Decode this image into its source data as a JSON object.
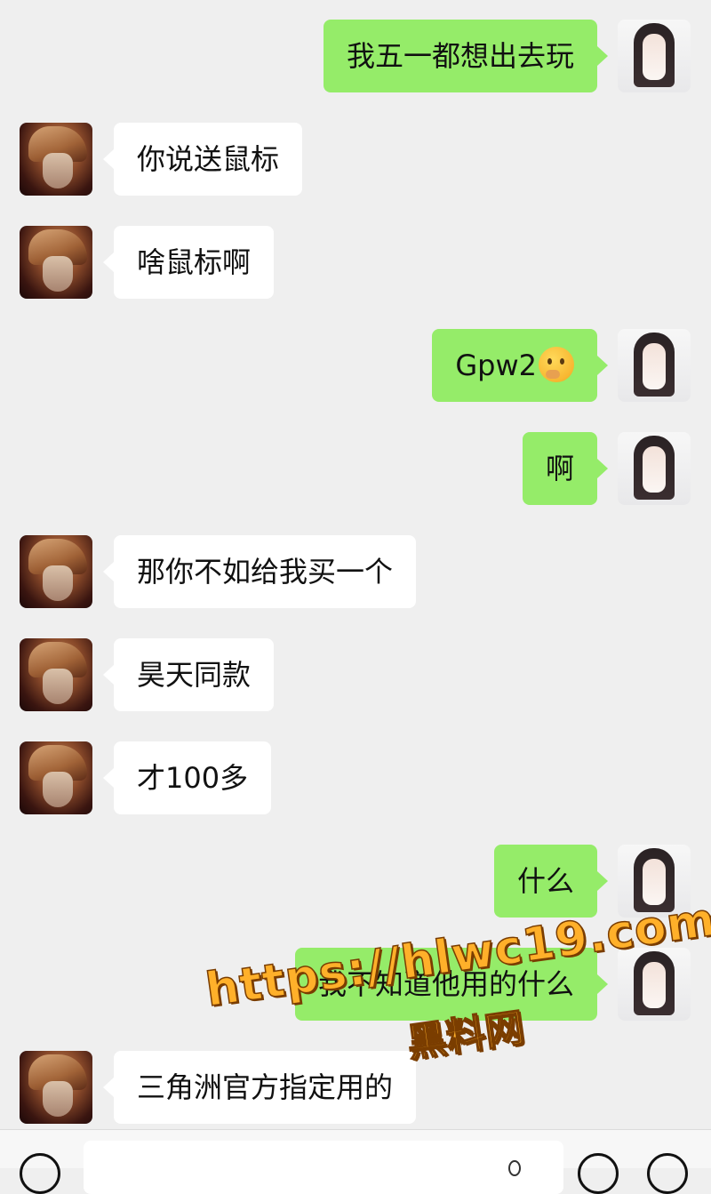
{
  "messages": [
    {
      "side": "right",
      "text": "我五一都想出去玩"
    },
    {
      "side": "left",
      "text": "你说送鼠标"
    },
    {
      "side": "left",
      "text": "啥鼠标啊"
    },
    {
      "side": "right",
      "text": "Gpw2",
      "emoji": "thinking-face-emoji"
    },
    {
      "side": "right",
      "text": "啊"
    },
    {
      "side": "left",
      "text": "那你不如给我买一个"
    },
    {
      "side": "left",
      "text": "昊天同款"
    },
    {
      "side": "left",
      "text": "才100多"
    },
    {
      "side": "right",
      "text": "什么"
    },
    {
      "side": "right",
      "text": "我不知道他用的什么"
    },
    {
      "side": "left",
      "text": "三角洲官方指定用的"
    }
  ],
  "watermark": {
    "url": "https://hlwc19.com",
    "site": "黑料网"
  },
  "colors": {
    "background": "#efefef",
    "bubble_sent": "#95ec69",
    "bubble_received": "#ffffff",
    "watermark": "#ffb02a"
  },
  "bottom_bar": {
    "icons": [
      "voice-icon",
      "emoji-icon",
      "plus-icon"
    ]
  }
}
